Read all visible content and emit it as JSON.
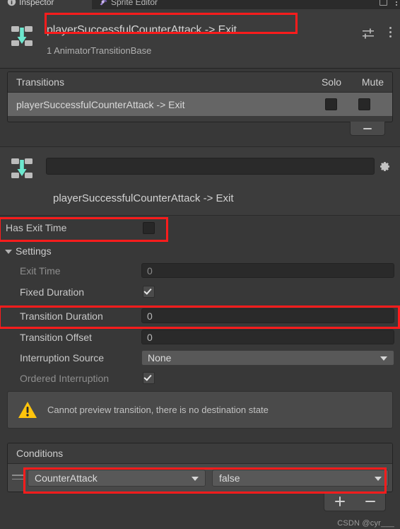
{
  "window": {
    "tabs": [
      {
        "label": "Inspector",
        "icon": "info-icon",
        "active": true
      },
      {
        "label": "Sprite Editor",
        "icon": "sprite-editor-icon",
        "active": false
      }
    ],
    "maximize_icon": "maximize-icon",
    "overflow_icon": "kebab-menu-icon"
  },
  "header": {
    "icon": "animator-transition-icon",
    "title": "playerSuccessfulCounterAttack -> Exit",
    "subtitle": "1 AnimatorTransitionBase",
    "presets_icon": "presets-sliders-icon",
    "menu_icon": "kebab-menu-icon"
  },
  "transitions_panel": {
    "header_label": "Transitions",
    "solo_label": "Solo",
    "mute_label": "Mute",
    "rows": [
      {
        "name": "playerSuccessfulCounterAttack -> Exit",
        "solo": false,
        "mute": false
      }
    ],
    "remove_button_icon": "minus-icon"
  },
  "name_block": {
    "icon": "animator-transition-icon",
    "field_value": "",
    "field_placeholder": "",
    "gear_icon": "gear-icon",
    "transition_name": "playerSuccessfulCounterAttack -> Exit"
  },
  "has_exit_time": {
    "label": "Has Exit Time",
    "checked": false
  },
  "settings": {
    "foldout_label": "Settings",
    "expanded": true,
    "foldout_icon": "chevron-down-icon",
    "rows": [
      {
        "label": "Exit Time",
        "type": "number",
        "value": "0",
        "disabled": true
      },
      {
        "label": "Fixed Duration",
        "type": "checkbox",
        "checked": true,
        "disabled": false
      },
      {
        "label": "Transition Duration",
        "type": "number",
        "value": "0",
        "disabled": false
      },
      {
        "label": "Transition Offset",
        "type": "number",
        "value": "0",
        "disabled": false
      },
      {
        "label": "Interruption Source",
        "type": "dropdown",
        "value": "None",
        "disabled": false
      },
      {
        "label": "Ordered Interruption",
        "type": "checkbox",
        "checked": true,
        "disabled": true
      }
    ]
  },
  "warning": {
    "icon": "warning-triangle-icon",
    "text": "Cannot preview transition, there is no destination state",
    "color": "#ffc107"
  },
  "conditions": {
    "header_label": "Conditions",
    "rows": [
      {
        "parameter": "CounterAttack",
        "value": "false",
        "drag_icon": "drag-handle-icon"
      }
    ],
    "add_icon": "plus-icon",
    "remove_icon": "minus-icon"
  },
  "annotations": {
    "highlight_color": "#fd1c1c",
    "boxes": [
      "title",
      "has-exit-time",
      "transition-duration",
      "condition-row"
    ]
  },
  "watermark": {
    "text": "CSDN @cyr___"
  }
}
